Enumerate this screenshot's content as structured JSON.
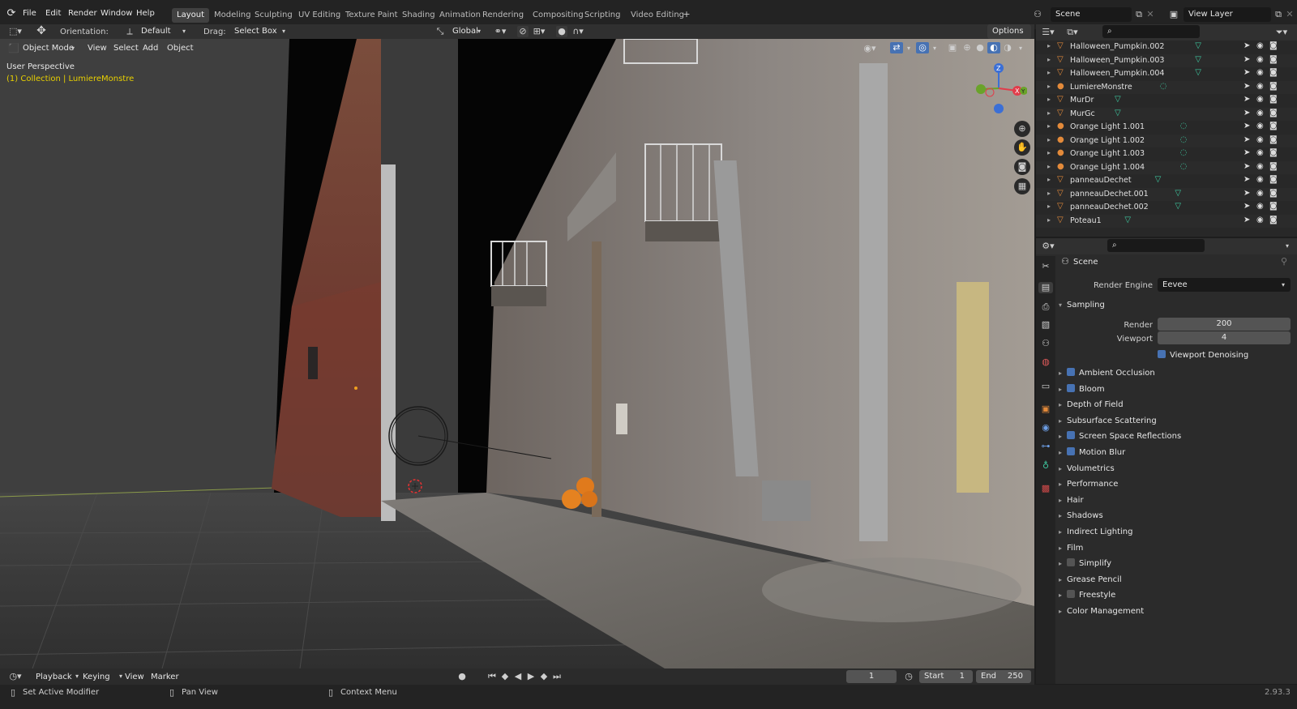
{
  "menus": [
    "File",
    "Edit",
    "Render",
    "Window",
    "Help"
  ],
  "workspaces": [
    "Layout",
    "Modeling",
    "Sculpting",
    "UV Editing",
    "Texture Paint",
    "Shading",
    "Animation",
    "Rendering",
    "Compositing",
    "Scripting",
    "Video Editing"
  ],
  "active_workspace": "Layout",
  "scene": "Scene",
  "view_layer": "View Layer",
  "tool_header": {
    "orientation_label": "Orientation:",
    "orientation_value": "Default",
    "drag_label": "Drag:",
    "drag_value": "Select Box",
    "transform_orientation": "Global",
    "options": "Options"
  },
  "viewport_header": {
    "mode": "Object Mode",
    "menus": [
      "View",
      "Select",
      "Add",
      "Object"
    ]
  },
  "viewport": {
    "perspective": "User Perspective",
    "collection": "(1) Collection | LumiereMonstre"
  },
  "outliner": {
    "items": [
      {
        "name": "Halloween_Pumpkin.002",
        "type": "mesh"
      },
      {
        "name": "Halloween_Pumpkin.003",
        "type": "mesh"
      },
      {
        "name": "Halloween_Pumpkin.004",
        "type": "mesh"
      },
      {
        "name": "LumiereMonstre",
        "type": "light"
      },
      {
        "name": "MurDr",
        "type": "mesh"
      },
      {
        "name": "MurGc",
        "type": "mesh"
      },
      {
        "name": "Orange Light 1.001",
        "type": "light"
      },
      {
        "name": "Orange Light 1.002",
        "type": "light"
      },
      {
        "name": "Orange Light 1.003",
        "type": "light"
      },
      {
        "name": "Orange Light 1.004",
        "type": "light"
      },
      {
        "name": "panneauDechet",
        "type": "mesh"
      },
      {
        "name": "panneauDechet.001",
        "type": "mesh"
      },
      {
        "name": "panneauDechet.002",
        "type": "mesh"
      },
      {
        "name": "Poteau1",
        "type": "mesh"
      }
    ]
  },
  "properties": {
    "context": "Scene",
    "render_engine_label": "Render Engine",
    "render_engine": "Eevee",
    "sampling": {
      "title": "Sampling",
      "render_label": "Render",
      "render": "200",
      "viewport_label": "Viewport",
      "viewport": "4",
      "denoise_label": "Viewport Denoising",
      "denoise": true
    },
    "panels": [
      {
        "label": "Ambient Occlusion",
        "checkbox": true,
        "checked": true
      },
      {
        "label": "Bloom",
        "checkbox": true,
        "checked": true
      },
      {
        "label": "Depth of Field",
        "checkbox": false
      },
      {
        "label": "Subsurface Scattering",
        "checkbox": false
      },
      {
        "label": "Screen Space Reflections",
        "checkbox": true,
        "checked": true
      },
      {
        "label": "Motion Blur",
        "checkbox": true,
        "checked": true
      },
      {
        "label": "Volumetrics",
        "checkbox": false
      },
      {
        "label": "Performance",
        "checkbox": false
      },
      {
        "label": "Hair",
        "checkbox": false
      },
      {
        "label": "Shadows",
        "checkbox": false
      },
      {
        "label": "Indirect Lighting",
        "checkbox": false
      },
      {
        "label": "Film",
        "checkbox": false
      },
      {
        "label": "Simplify",
        "checkbox": true,
        "checked": false
      },
      {
        "label": "Grease Pencil",
        "checkbox": false
      },
      {
        "label": "Freestyle",
        "checkbox": true,
        "checked": false
      },
      {
        "label": "Color Management",
        "checkbox": false
      }
    ]
  },
  "timeline": {
    "menus": [
      "Playback",
      "Keying",
      "View",
      "Marker"
    ],
    "current_frame": "1",
    "start_label": "Start",
    "start": "1",
    "end_label": "End",
    "end": "250"
  },
  "status": {
    "set_active_modifier": "Set Active Modifier",
    "pan_view": "Pan View",
    "context_menu": "Context Menu",
    "version": "2.93.3"
  },
  "colors": {
    "accent": "#4772b3",
    "mesh_icon": "#e38a3a",
    "constraint_icon": "#3ec9a0",
    "modifier_icon": "#6d9fe6",
    "highlight_text": "#e8d000"
  }
}
